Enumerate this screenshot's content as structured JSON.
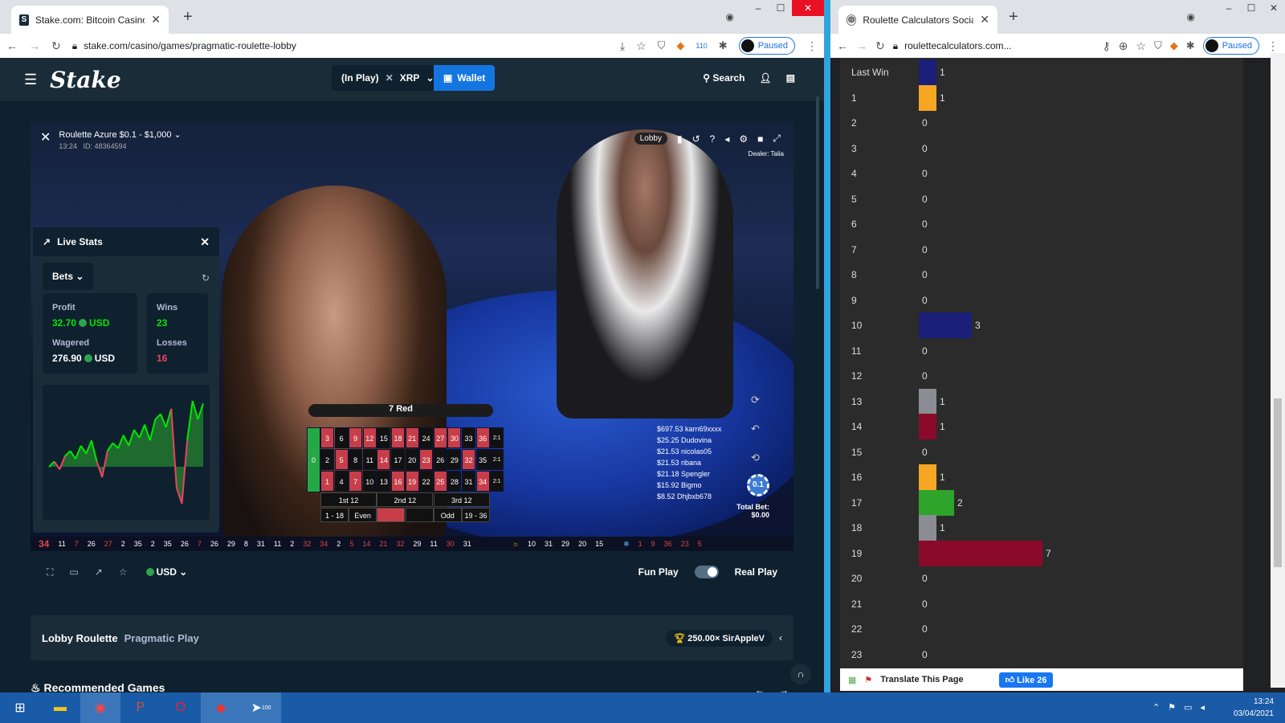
{
  "left_browser": {
    "tab_title": "Stake.com: Bitcoin Casino & Spo",
    "url": "stake.com/casino/games/pragmatic-roulette-lobby",
    "paused": "Paused",
    "ext_badge": "110"
  },
  "stake": {
    "balance_label": "(In Play)",
    "currency": "XRP",
    "wallet": "Wallet",
    "search": "Search",
    "game_name": "Roulette Azure $0.1 - $1,000",
    "game_time": "13:24",
    "game_id": "ID: 48364594",
    "lobby": "Lobby",
    "dealer": "Dealer: Talia",
    "result": "7 Red",
    "live_stats": "Live Stats",
    "bets_select": "Bets",
    "profit_label": "Profit",
    "profit_value": "32.70",
    "profit_ccy": "USD",
    "wins_label": "Wins",
    "wins_value": "23",
    "wagered_label": "Wagered",
    "wagered_value": "276.90",
    "wagered_ccy": "USD",
    "losses_label": "Losses",
    "losses_value": "16",
    "graph": [
      0,
      2,
      -1,
      4,
      6,
      3,
      8,
      5,
      10,
      2,
      -4,
      6,
      9,
      7,
      12,
      8,
      14,
      11,
      16,
      10,
      18,
      20,
      15,
      22,
      -8,
      -14,
      10,
      25,
      18,
      24
    ],
    "board_rows": [
      [
        3,
        6,
        9,
        12,
        15,
        18,
        21,
        24,
        27,
        30,
        33,
        36
      ],
      [
        2,
        5,
        8,
        11,
        14,
        17,
        20,
        23,
        26,
        29,
        32,
        35
      ],
      [
        1,
        4,
        7,
        10,
        13,
        16,
        19,
        22,
        25,
        28,
        31,
        34
      ]
    ],
    "red_numbers": [
      1,
      3,
      5,
      7,
      9,
      12,
      14,
      16,
      18,
      19,
      21,
      23,
      25,
      27,
      30,
      32,
      34,
      36
    ],
    "col_label": "2:1",
    "dozens": [
      "1st 12",
      "2nd 12",
      "3rd 12"
    ],
    "outside": [
      "1 - 18",
      "Even",
      "",
      "",
      "Odd",
      "19 - 36"
    ],
    "bets_list": [
      "$697.53 karn69xxxx",
      "$25.25 Dudovina",
      "$21.53 nicolas05",
      "$21.53 ribana",
      "$21.18 Spengler",
      "$15.92 Bigmo",
      "$8.52 Dhjbxb678"
    ],
    "chip": "0.1",
    "total_bet_label": "Total Bet:",
    "total_bet": "$0.00",
    "history": [
      "34",
      "11",
      "7",
      "26",
      "27",
      "2",
      "35",
      "2",
      "35",
      "26",
      "7",
      "26",
      "29",
      "8",
      "31",
      "11",
      "2",
      "32",
      "34",
      "2",
      "5",
      "14",
      "21",
      "32",
      "29",
      "11",
      "30",
      "31"
    ],
    "hot": [
      "10",
      "31",
      "29",
      "20",
      "15"
    ],
    "cold": [
      "1",
      "9",
      "36",
      "23",
      "5"
    ],
    "currency_sel": "USD",
    "fun_play": "Fun Play",
    "real_play": "Real Play",
    "lobby_title": "Lobby Roulette",
    "provider": "Pragmatic Play",
    "big_win": "250.00× SirAppleV",
    "recommended": "Recommended Games"
  },
  "right_browser": {
    "tab_title": "Roulette Calculators Social Netw",
    "url": "roulettecalculators.com...",
    "paused": "Paused",
    "rows": [
      {
        "label": "Last Win",
        "count": 1,
        "color": "#1a1f7a"
      },
      {
        "label": "1",
        "count": 1,
        "color": "#f5a623"
      },
      {
        "label": "2",
        "count": 0,
        "color": ""
      },
      {
        "label": "3",
        "count": 0,
        "color": ""
      },
      {
        "label": "4",
        "count": 0,
        "color": ""
      },
      {
        "label": "5",
        "count": 0,
        "color": ""
      },
      {
        "label": "6",
        "count": 0,
        "color": ""
      },
      {
        "label": "7",
        "count": 0,
        "color": ""
      },
      {
        "label": "8",
        "count": 0,
        "color": ""
      },
      {
        "label": "9",
        "count": 0,
        "color": ""
      },
      {
        "label": "10",
        "count": 3,
        "color": "#1a1f7a"
      },
      {
        "label": "11",
        "count": 0,
        "color": ""
      },
      {
        "label": "12",
        "count": 0,
        "color": ""
      },
      {
        "label": "13",
        "count": 1,
        "color": "#8a8d94"
      },
      {
        "label": "14",
        "count": 1,
        "color": "#8b0a2a"
      },
      {
        "label": "15",
        "count": 0,
        "color": ""
      },
      {
        "label": "16",
        "count": 1,
        "color": "#f5a623"
      },
      {
        "label": "17",
        "count": 2,
        "color": "#2ea42a"
      },
      {
        "label": "18",
        "count": 1,
        "color": "#8a8d94"
      },
      {
        "label": "19",
        "count": 7,
        "color": "#8b0a2a"
      },
      {
        "label": "20",
        "count": 0,
        "color": ""
      },
      {
        "label": "21",
        "count": 0,
        "color": ""
      },
      {
        "label": "22",
        "count": 0,
        "color": ""
      },
      {
        "label": "23",
        "count": 0,
        "color": ""
      }
    ],
    "translate": "Translate This Page",
    "like": "Like 26"
  },
  "taskbar": {
    "time": "13:24",
    "date": "03/04/2021",
    "telegram_badge": "100"
  }
}
